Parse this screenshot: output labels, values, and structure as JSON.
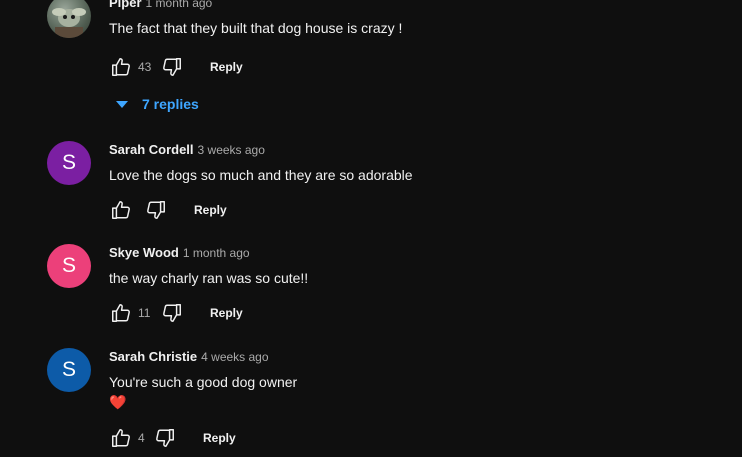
{
  "comments": [
    {
      "author": "Piper",
      "time": "1 month ago",
      "text": "The fact that they built that dog house is crazy !",
      "likes": "43",
      "reply_label": "Reply",
      "avatar_letter": ""
    },
    {
      "author": "Sarah Cordell",
      "time": "3 weeks ago",
      "text": "Love the dogs so much and they are so adorable",
      "likes": "",
      "reply_label": "Reply",
      "avatar_letter": "S",
      "avatar_color": "#7b1fa2"
    },
    {
      "author": "Skye Wood",
      "time": "1 month ago",
      "text": "the way charly ran was so cute!!",
      "likes": "11",
      "reply_label": "Reply",
      "avatar_letter": "S",
      "avatar_color": "#ec407a"
    },
    {
      "author": "Sarah Christie",
      "time": "4 weeks ago",
      "text": "You're such a good dog owner",
      "emoji": "❤️",
      "likes": "4",
      "reply_label": "Reply",
      "avatar_letter": "S",
      "avatar_color": "#0d5ba8"
    }
  ],
  "replies_toggle": {
    "label": "7 replies",
    "color": "#3ea6ff"
  },
  "icons": {
    "like": "thumbs-up-icon",
    "dislike": "thumbs-down-icon",
    "expand": "caret-down-icon"
  }
}
